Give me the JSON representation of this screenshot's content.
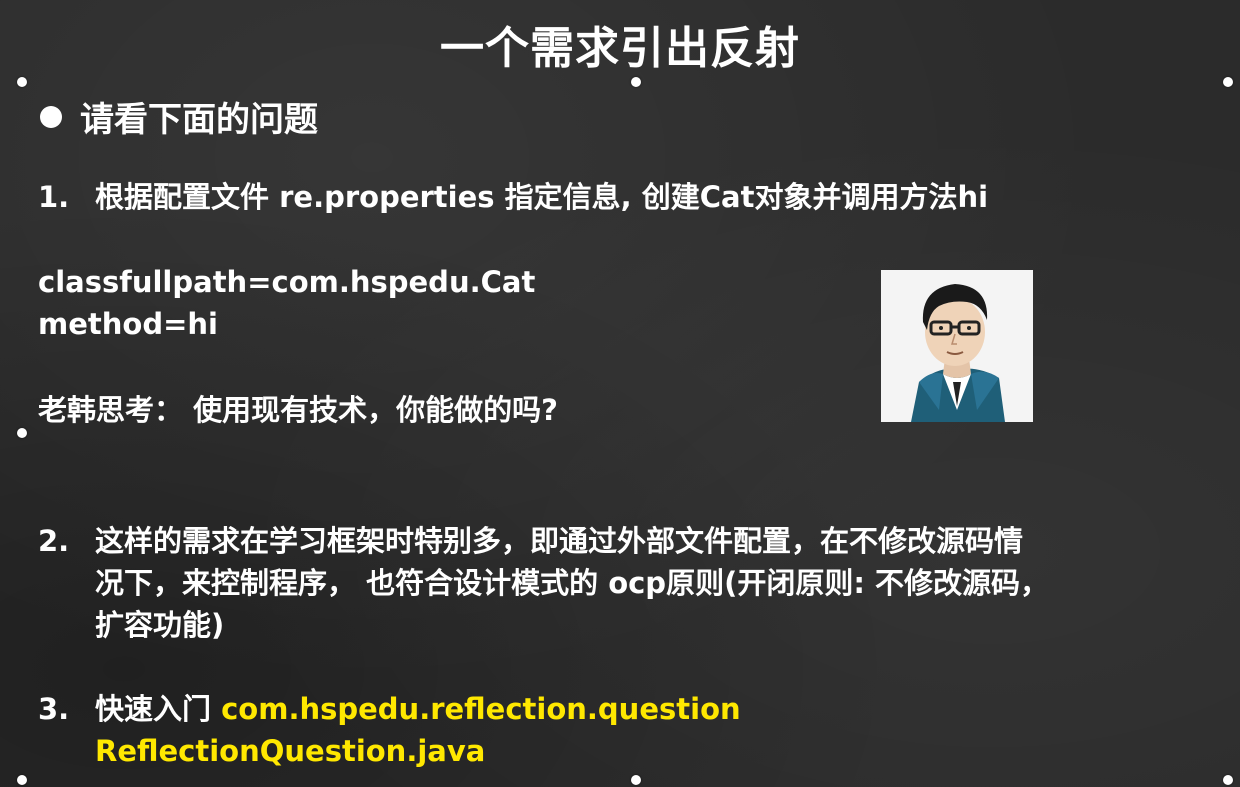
{
  "title": "一个需求引出反射",
  "heading": "请看下面的问题",
  "item1": {
    "num": "1.",
    "text": "根据配置文件 re.properties 指定信息, 创建Cat对象并调用方法hi"
  },
  "config": {
    "line1": "classfullpath=com.hspedu.Cat",
    "line2": "method=hi"
  },
  "thinking": "老韩思考：  使用现有技术，你能做的吗?",
  "item2": {
    "num": "2.",
    "line1": "这样的需求在学习框架时特别多，即通过外部文件配置，在不修改源码情",
    "line2": "况下，来控制程序，  也符合设计模式的 ocp原则(开闭原则: 不修改源码，",
    "line3": "扩容功能)"
  },
  "item3": {
    "num": "3.",
    "label": "快速入门 ",
    "package": "com.hspedu.reflection.question",
    "file": "ReflectionQuestion.java"
  },
  "colors": {
    "background": "#2b2b2b",
    "text": "#ffffff",
    "highlight": "#ffe800"
  }
}
